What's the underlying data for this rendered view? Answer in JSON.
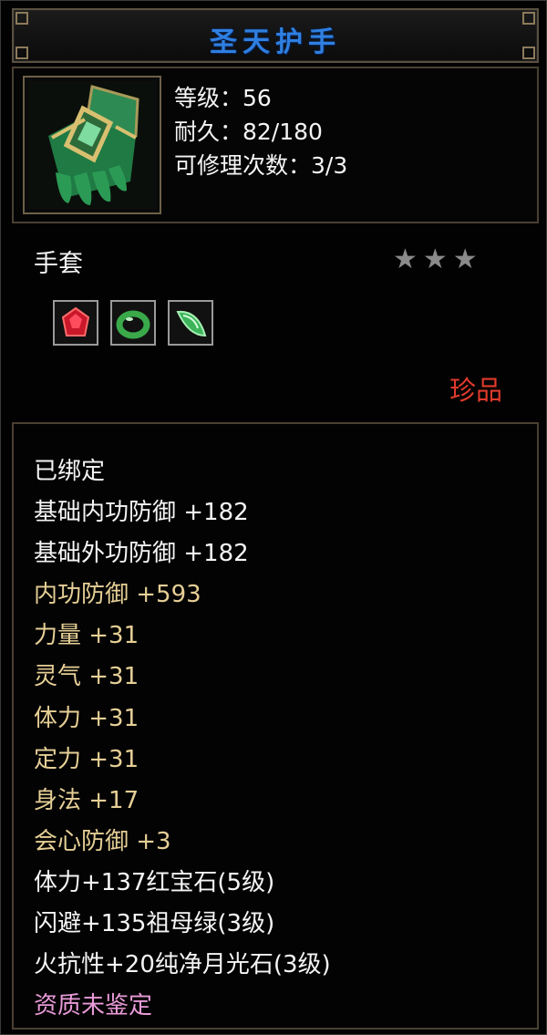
{
  "item": {
    "name": "圣天护手",
    "level_label": "等级：56",
    "durability_label": "耐久：82/180",
    "repair_label": "可修理次数：3/3",
    "type": "手套",
    "stars": "★★★",
    "quality": "珍品",
    "icon": "jade-gauntlet-icon"
  },
  "gems": [
    {
      "name": "ruby-gem-icon",
      "color": "#d81c2a"
    },
    {
      "name": "emerald-ring-gem-icon",
      "color": "#3aa94a"
    },
    {
      "name": "moonstone-gem-icon",
      "color": "#4fbf66"
    }
  ],
  "attributes": [
    {
      "text": "已绑定",
      "style": "white"
    },
    {
      "text": "基础内功防御  +182",
      "style": "white"
    },
    {
      "text": "基础外功防御  +182",
      "style": "white"
    },
    {
      "text": "内功防御  +593",
      "style": "gold"
    },
    {
      "text": "力量  +31",
      "style": "gold"
    },
    {
      "text": "灵气  +31",
      "style": "gold"
    },
    {
      "text": "体力  +31",
      "style": "gold"
    },
    {
      "text": "定力  +31",
      "style": "gold"
    },
    {
      "text": "身法  +17",
      "style": "gold"
    },
    {
      "text": "会心防御  +3",
      "style": "gold"
    },
    {
      "text": "体力+137红宝石(5级)",
      "style": "white"
    },
    {
      "text": "闪避+135祖母绿(3级)",
      "style": "white"
    },
    {
      "text": "火抗性+20纯净月光石(3级)",
      "style": "white"
    },
    {
      "text": "资质未鉴定",
      "style": "pink"
    }
  ],
  "colors": {
    "title": "#2f7fe0",
    "quality": "#e03a2c",
    "attribute_gold": "#e6cf96",
    "unidentified": "#e89ad8"
  }
}
